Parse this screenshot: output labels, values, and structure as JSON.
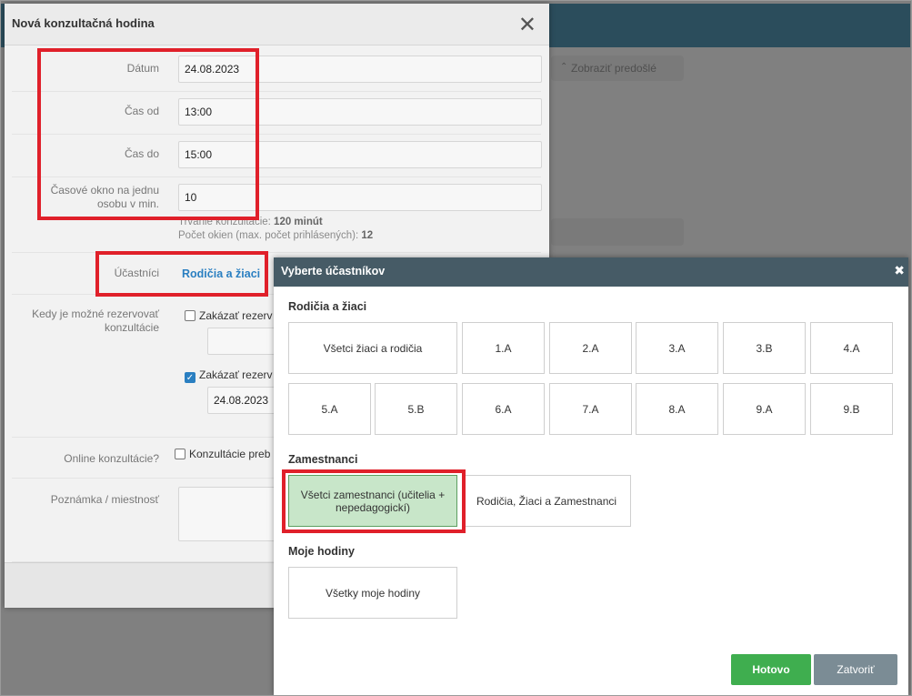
{
  "background": {
    "show_previous": "Zobraziť predošlé"
  },
  "form": {
    "title": "Nová konzultačná hodina",
    "date_label": "Dátum",
    "date_value": "24.08.2023",
    "time_from_label": "Čas od",
    "time_from_value": "13:00",
    "time_to_label": "Čas do",
    "time_to_value": "15:00",
    "slot_label": "Časové okno na jednu osobu v min.",
    "slot_value": "10",
    "duration_hint_label": "Trvanie konzultácie: ",
    "duration_hint_value": "120 minút",
    "slots_hint_label": "Počet okien (max. počet prihlásených): ",
    "slots_hint_value": "12",
    "participants_label": "Účastníci",
    "participants_value": "Rodičia a žiaci",
    "booking_label": "Kedy je možné rezervovať konzultácie",
    "booking_disable_from": "Zakázať rezerv",
    "booking_disable_to": "Zakázať rezerv",
    "booking_to_date": "24.08.2023",
    "online_label": "Online konzultácie?",
    "online_checkbox": "Konzultácie preb",
    "note_label": "Poznámka / miestnosť"
  },
  "dialog": {
    "title": "Vyberte účastníkov",
    "close": "✖",
    "section_parents": "Rodičia a žiaci",
    "all_students_parents": "Všetci žiaci a rodičia",
    "classes": [
      "1.A",
      "2.A",
      "3.A",
      "3.B",
      "4.A",
      "5.A",
      "5.B",
      "6.A",
      "7.A",
      "8.A",
      "9.A",
      "9.B"
    ],
    "section_staff": "Zamestnanci",
    "all_staff": "Všetci zamestnanci (učitelia + nepedagogickí)",
    "parents_students_staff": "Rodičia, Žiaci a Zamestnanci",
    "section_mine": "Moje hodiny",
    "all_my_hours": "Všetky moje hodiny",
    "done": "Hotovo",
    "close_btn": "Zatvoriť"
  },
  "colors": {
    "header_bg": "#2b4d5c",
    "dialog_header": "#465b66",
    "selected_tile": "#c8e6c9",
    "done_button": "#3fae4f",
    "close_button": "#7b8c95",
    "link_blue": "#2a7fc1",
    "highlight_red": "#e0202a"
  }
}
